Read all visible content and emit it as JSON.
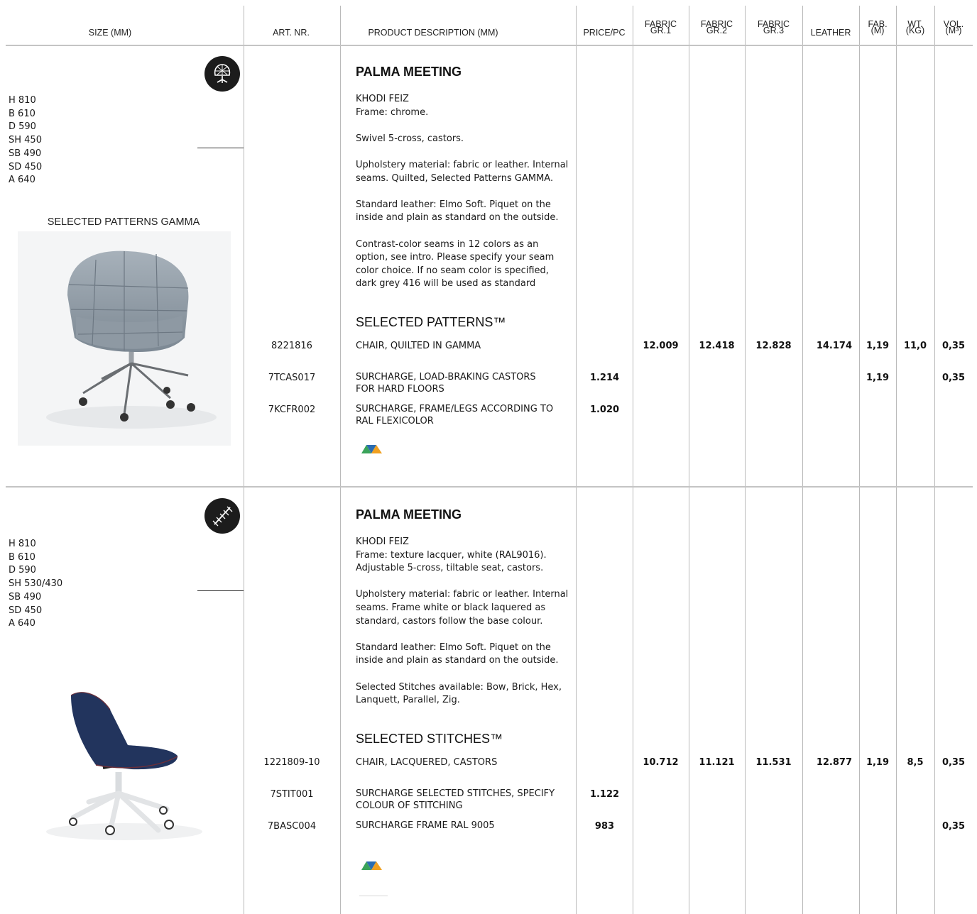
{
  "header": {
    "size": "SIZE (MM)",
    "art_nr": "ART. NR.",
    "description": "PRODUCT DESCRIPTION (MM)",
    "price": "PRICE/PC",
    "fabric1_top": "FABRIC",
    "fabric1_bottom": "GR.1",
    "fabric2_top": "FABRIC",
    "fabric2_bottom": "GR.2",
    "fabric3_top": "FABRIC",
    "fabric3_bottom": "GR.3",
    "leather": "LEATHER",
    "fab_top": "FAB.",
    "fab_bottom": "(M)",
    "wt_top": "WT.",
    "wt_bottom": "(KG)",
    "vol_top": "VOL.",
    "vol_bottom": "(M³)"
  },
  "products": [
    {
      "icon": "quilted-chair-swivel-icon",
      "sizes": [
        "H 810",
        "B 610",
        "D 590",
        "SH 450",
        "SB 490",
        "SD 450",
        "A 640"
      ],
      "pattern_caption": "SELECTED PATTERNS GAMMA",
      "image": "grey-quilted-swivel-chair",
      "title": "PALMA MEETING",
      "designer": "KHODI FEIZ",
      "paragraphs": [
        "Frame: chrome.",
        "Swivel 5-cross, castors.",
        "Upholstery material: fabric or leather. Internal seams. Quilted, Selected Patterns GAMMA.",
        "Standard leather: Elmo Soft. Piquet on the inside and plain as standard on the outside.",
        "Contrast-color seams in 12 colors as an option, see intro. Please specify your seam color choice. If no seam color is specified, dark grey 416 will be used as standard"
      ],
      "subheading": "SELECTED PATTERNS™",
      "rows": [
        {
          "art": "8221816",
          "desc": [
            "CHAIR, QUILTED IN GAMMA"
          ],
          "price": "",
          "f1": "12.009",
          "f2": "12.418",
          "f3": "12.828",
          "leather": "14.174",
          "fab": "1,19",
          "wt": "11,0",
          "vol": "0,35"
        },
        {
          "art": "7TCAS017",
          "desc": [
            "SURCHARGE, LOAD-BRAKING CASTORS",
            "FOR HARD FLOORS"
          ],
          "price": "1.214",
          "f1": "",
          "f2": "",
          "f3": "",
          "leather": "",
          "fab": "1,19",
          "wt": "",
          "vol": "0,35"
        },
        {
          "art": "7KCFR002",
          "desc": [
            "SURCHARGE, FRAME/LEGS ACCORDING TO",
            "RAL FLEXICOLOR"
          ],
          "price": "1.020",
          "f1": "",
          "f2": "",
          "f3": "",
          "leather": "",
          "fab": "",
          "wt": "",
          "vol": ""
        }
      ],
      "logo": "triangles-logo"
    },
    {
      "icon": "stitches-icon",
      "sizes": [
        "H 810",
        "B 610",
        "D 590",
        "SH 530/430",
        "SB 490",
        "SD 450",
        "A 640"
      ],
      "image": "blue-swivel-chair-white-base",
      "title": "PALMA MEETING",
      "designer": "KHODI FEIZ",
      "paragraphs": [
        "Frame: texture lacquer, white (RAL9016). Adjustable 5-cross, tiltable seat, castors.",
        "Upholstery material: fabric or leather. Internal seams. Frame white or black laquered as standard, castors follow the base colour.",
        "Standard leather: Elmo Soft. Piquet on the inside and plain as standard on the outside.",
        "Selected Stitches available: Bow, Brick, Hex, Lanquett, Parallel, Zig."
      ],
      "subheading": "SELECTED STITCHES™",
      "rows": [
        {
          "art": "1221809-10",
          "desc": [
            "CHAIR, LACQUERED, CASTORS"
          ],
          "price": "",
          "f1": "10.712",
          "f2": "11.121",
          "f3": "11.531",
          "leather": "12.877",
          "fab": "1,19",
          "wt": "8,5",
          "vol": "0,35"
        },
        {
          "art": "7STIT001",
          "desc": [
            "SURCHARGE SELECTED STITCHES, SPECIFY",
            "COLOUR OF STITCHING"
          ],
          "price": "1.122",
          "f1": "",
          "f2": "",
          "f3": "",
          "leather": "",
          "fab": "",
          "wt": "",
          "vol": ""
        },
        {
          "art": "7BASC004",
          "desc": [
            "SURCHARGE FRAME RAL 9005"
          ],
          "price": "983",
          "f1": "",
          "f2": "",
          "f3": "",
          "leather": "",
          "fab": "",
          "wt": "",
          "vol": "0,35"
        }
      ],
      "logo": "triangles-logo"
    }
  ],
  "colors": {
    "rule": "#c4c4c4",
    "icon_bg": "#1c1c1c",
    "logo_green": "#3aa35a",
    "logo_blue": "#2b6cb0",
    "logo_orange": "#f0a020"
  }
}
